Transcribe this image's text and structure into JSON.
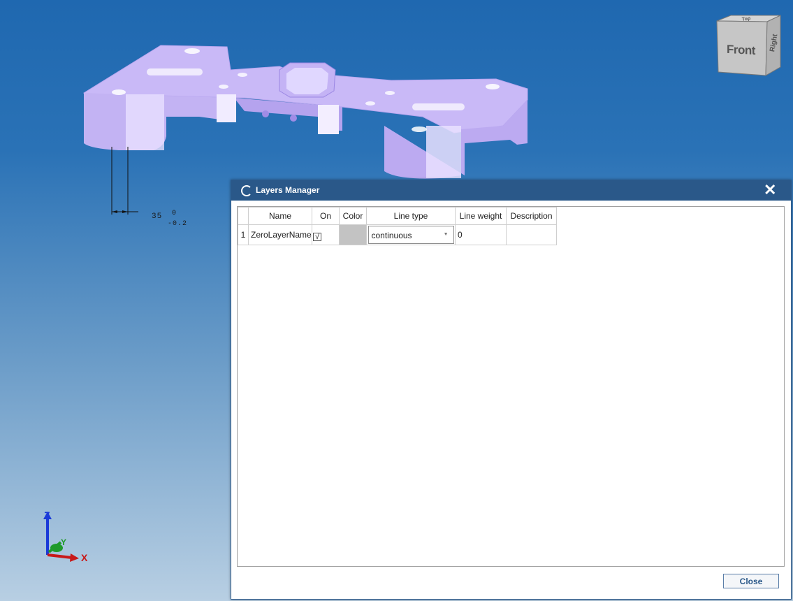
{
  "viewport": {
    "dimension": {
      "value": "35",
      "upper_tol": "0",
      "lower_tol": "-0.2"
    },
    "viewcube": {
      "front_label": "Front",
      "right_label": "Right",
      "top_label": "Top"
    },
    "axes": {
      "x": "X",
      "y": "Y",
      "z": "Z"
    },
    "colors": {
      "part": "#c3b5f5",
      "background_top": "#1f68b0",
      "background_bottom": "#b8cfe3"
    }
  },
  "dialog": {
    "title": "Layers Manager",
    "close_label": "Close",
    "columns": [
      "Name",
      "On",
      "Color",
      "Line type",
      "Line weight",
      "Description"
    ],
    "rows": [
      {
        "index": "1",
        "name": "ZeroLayerName",
        "on": true,
        "on_mark": "√",
        "color": "#c3c3c3",
        "line_type": "continuous",
        "line_weight": "0",
        "description": ""
      }
    ]
  }
}
